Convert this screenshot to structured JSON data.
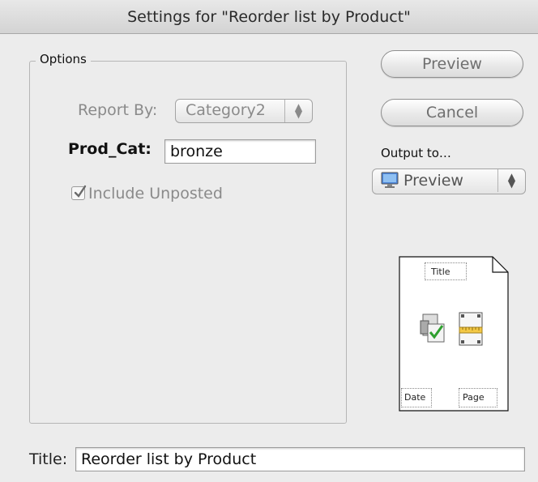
{
  "window": {
    "title": "Settings for \"Reorder list by Product\""
  },
  "options": {
    "group_label": "Options",
    "report_by_label": "Report By:",
    "report_by_value": "Category2",
    "prod_cat_label": "Prod_Cat:",
    "prod_cat_value": "bronze",
    "include_unposted_label": "Include Unposted",
    "include_unposted_checked": true
  },
  "buttons": {
    "preview": "Preview",
    "cancel": "Cancel"
  },
  "output": {
    "label": "Output to…",
    "value": "Preview",
    "icon": "monitor-icon"
  },
  "page_preview": {
    "title": "Title",
    "date": "Date",
    "page": "Page",
    "icons": [
      "print-check-icon",
      "ruler-page-icon"
    ]
  },
  "footer": {
    "title_label": "Title:",
    "title_value": "Reorder list by Product"
  }
}
